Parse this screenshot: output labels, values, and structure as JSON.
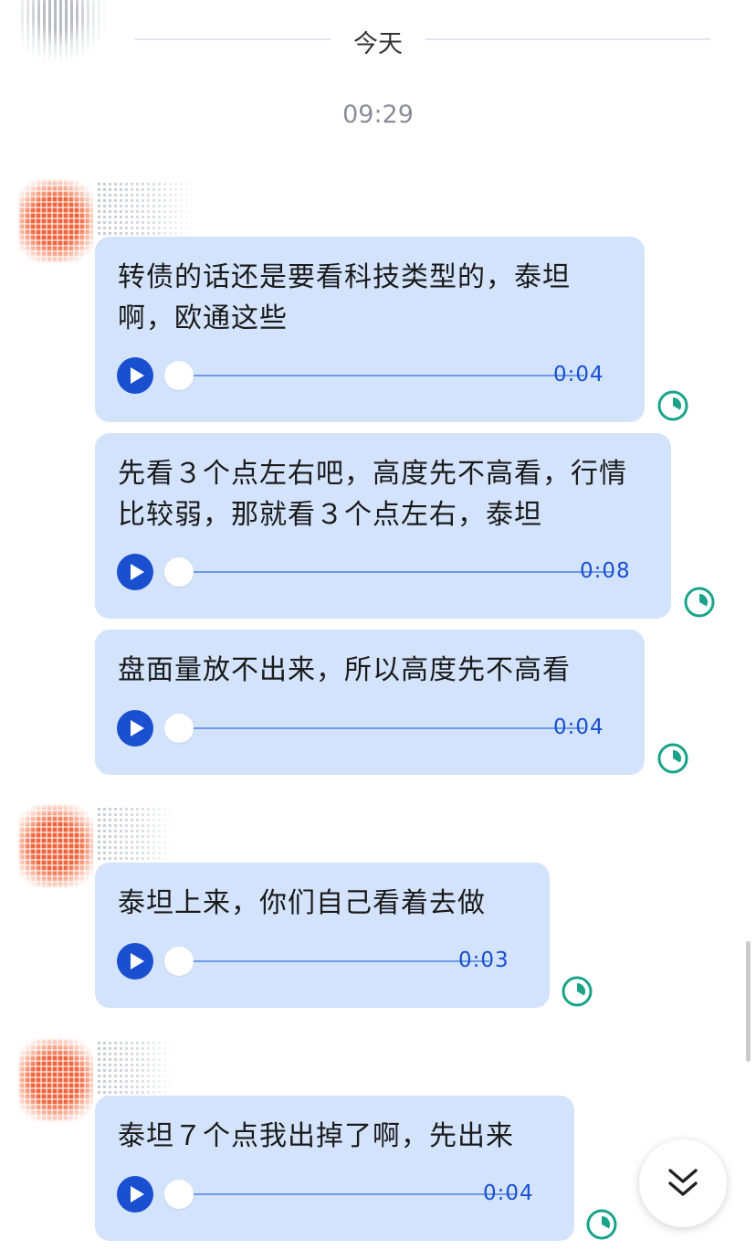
{
  "header": {
    "day_label": "今天",
    "time_label": "09:29"
  },
  "messages": [
    {
      "text": "转债的话还是要看科技类型的，泰坦啊，欧通这些",
      "duration": "0:04"
    },
    {
      "text": "先看３个点左右吧，高度先不高看，行情比较弱，那就看３个点左右，泰坦",
      "duration": "0:08"
    },
    {
      "text": "盘面量放不出来，所以高度先不高看",
      "duration": "0:04"
    },
    {
      "text": "泰坦上来，你们自己看着去做",
      "duration": "0:03"
    },
    {
      "text": "泰坦７个点我出掉了啊，先出来",
      "duration": "0:04"
    }
  ],
  "colors": {
    "bubble": "#d3e3fc",
    "accent": "#1a4fd0",
    "status": "#1aa38a"
  },
  "icons": {
    "play": "play-icon",
    "status": "clock-status-icon",
    "jump": "double-chevron-down-icon"
  }
}
